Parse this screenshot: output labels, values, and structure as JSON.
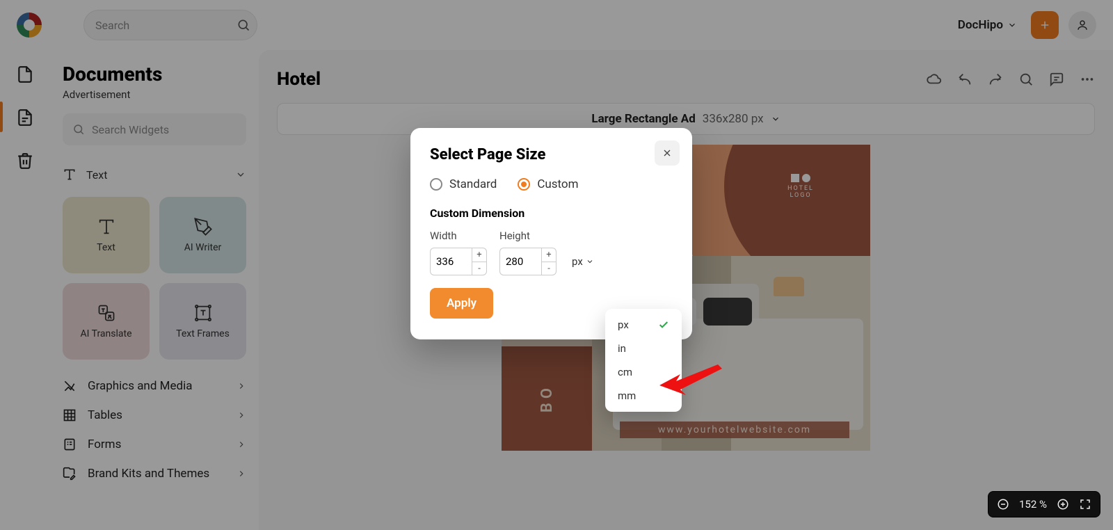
{
  "header": {
    "search_placeholder": "Search",
    "workspace_label": "DocHipo"
  },
  "panel": {
    "title": "Documents",
    "subtitle": "Advertisement",
    "widget_search_placeholder": "Search Widgets",
    "text_section": "Text",
    "tiles": {
      "text": "Text",
      "ai_writer": "AI Writer",
      "ai_translate": "AI Translate",
      "text_frames": "Text Frames"
    },
    "sections": {
      "graphics": "Graphics and Media",
      "tables": "Tables",
      "forms": "Forms",
      "brand": "Brand Kits and Themes"
    }
  },
  "canvas": {
    "title": "Hotel",
    "size_label": "Large Rectangle Ad",
    "size_dim": "336x280 px",
    "ad": {
      "logo_l1": "HOTEL",
      "logo_l2": "LOGO",
      "side_text": "BO",
      "url": "www.yourhotelwebsite.com"
    }
  },
  "modal": {
    "title": "Select Page Size",
    "standard": "Standard",
    "custom": "Custom",
    "custom_dim": "Custom Dimension",
    "width_label": "Width",
    "height_label": "Height",
    "width_value": "336",
    "height_value": "280",
    "unit_label": "px",
    "apply": "Apply"
  },
  "unit_menu": {
    "px": "px",
    "in": "in",
    "cm": "cm",
    "mm": "mm",
    "selected": "px"
  },
  "zoom": {
    "pct": "152 %"
  }
}
